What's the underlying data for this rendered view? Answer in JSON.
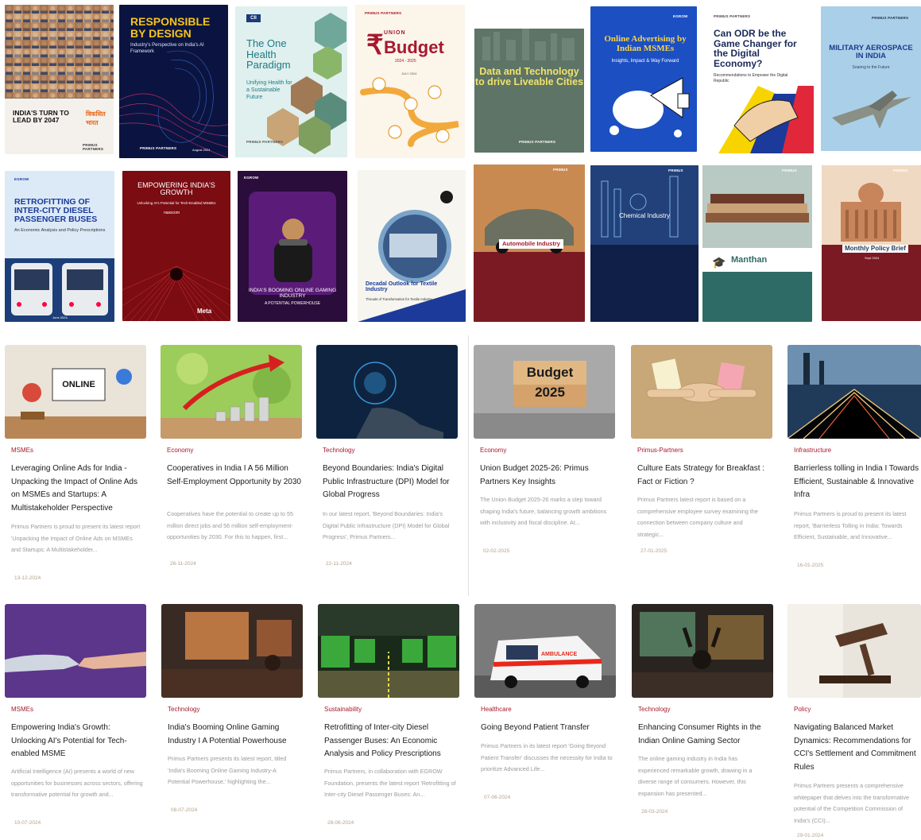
{
  "covers_row1": [
    {
      "title": "INDIA'S TURN TO LEAD BY 2047",
      "badge": "विकसित भारत",
      "brand": "PRIMUS PARTNERS"
    },
    {
      "title": "RESPONSIBLE BY DESIGN",
      "subtitle": "Industry's Perspective on India's AI Framework",
      "date": "August 2024",
      "brand": "PRIMUS PARTNERS"
    },
    {
      "org": "CII",
      "title": "The One Health Paradigm",
      "subtitle": "Unifying Health for a Sustainable Future",
      "brand": "PRIMUS PARTNERS"
    },
    {
      "brand": "PRIMUS PARTNERS",
      "title": "Budget",
      "prefix": "UNION",
      "years": "2024 - 2025",
      "date": "JULY 2024"
    },
    {
      "title": "Data and Technology to drive Liveable Cities",
      "brand": "PRIMUS PARTNERS"
    },
    {
      "brand": "EGROW",
      "title": "Online Advertising by Indian MSMEs",
      "subtitle": "Insights, Impact & Way Forward"
    },
    {
      "brand": "PRIMUS PARTNERS",
      "title": "Can ODR be the Game Changer for the Digital Economy?",
      "subtitle": "Recommendations to Empower the Digital Republic"
    },
    {
      "brand": "PRIMUS PARTNERS",
      "title": "MILITARY AEROSPACE IN INDIA",
      "subtitle": "Soaring to the Future"
    }
  ],
  "covers_row2": [
    {
      "brand": "EGROW",
      "title": "RETROFITTING OF INTER-CITY DIESEL PASSENGER BUSES",
      "subtitle": "An Economic Analysis and Policy Prescriptions",
      "date": "June 2024"
    },
    {
      "title": "EMPOWERING INDIA'S GROWTH",
      "subtitle": "Unlocking AI's Potential for Tech-Enabled MSMEs",
      "org": "nasscom",
      "partner": "Meta"
    },
    {
      "brand": "EGROW",
      "title": "INDIA'S BOOMING ONLINE GAMING INDUSTRY",
      "subtitle": "A POTENTIAL POWERHOUSE"
    },
    {
      "title": "Decadal Outlook for Textile Industry",
      "subtitle": "Threads of Transformation for Textile Industry"
    },
    {
      "brand": "PRIMUS",
      "title": "Automobile Industry"
    },
    {
      "brand": "PRIMUS",
      "title": "Chemical Industry"
    },
    {
      "brand": "PRIMUS",
      "title": "Manthan"
    },
    {
      "brand": "PRIMUS",
      "title": "Monthly Policy Brief",
      "date": "Sept 2024"
    }
  ],
  "articles_row1": [
    {
      "category": "MSMEs",
      "title": "Leveraging Online Ads for India - Unpacking the Impact of Online Ads on MSMEs and Startups: A Multistakeholder Perspective",
      "excerpt": "Primus Partners is proud to present its latest report 'Unpacking the Impact of Online Ads on MSMEs and Startups: A Multistakeholder...",
      "date": "13-12-2024",
      "thumb_label": "ONLINE"
    },
    {
      "category": "Economy",
      "title": "Cooperatives in India I A 56 Million Self-Employment Opportunity by 2030",
      "excerpt": "Cooperatives have the potential to create up to 55 million direct jobs and 56 million self-employment-opportunities by 2030. For this to happen, first...",
      "date": "26-11-2024"
    },
    {
      "category": "Technology",
      "title": "Beyond Boundaries: India's Digital Public Infrastructure (DPI) Model for Global Progress",
      "excerpt": "In our latest report, 'Beyond Boundaries: India's Digital Public Infrastructure (DPI) Model for Global Progress', Primus Partners...",
      "date": "22-11-2024"
    },
    {
      "category": "Economy",
      "title": "Union Budget 2025-26: Primus Partners Key Insights",
      "excerpt": "The Union Budget 2025-26 marks a step toward shaping India's future, balancing growth ambitions with inclusivity and fiscal discipline. At...",
      "date": "02-02-2025",
      "thumb_label": "Budget 2025"
    },
    {
      "category": "Primus-Partners",
      "title": "Culture Eats Strategy for Breakfast : Fact or Fiction ?",
      "excerpt": "Primus Partners latest report is based on a comprehensive employee survey examining the connection between company culture and strategic...",
      "date": "27-01-2025"
    },
    {
      "category": "Infrastructure",
      "title": "Barrierless tolling in India I Towards Efficient, Sustainable & Innovative Infra",
      "excerpt": "Primus Partners is proud to present its latest report, 'Barrierless Tolling in India: Towards Efficient, Sustainable, and Innovative...",
      "date": "16-01-2025"
    }
  ],
  "articles_row2": [
    {
      "category": "MSMEs",
      "title": "Empowering India's Growth: Unlocking AI's Potential for Tech-enabled MSME",
      "excerpt": "Artificial Intelligence (AI) presents a world of new opportunities for businesses across sectors, offering transformative potential for growth and...",
      "date": "10-07-2024"
    },
    {
      "category": "Technology",
      "title": "India's Booming Online Gaming Industry I A Potential Powerhouse",
      "excerpt": "Primus Partners presents its latest report, titled 'India's Booming Online Gaming Industry-A Potential Powerhouse,' highlighting the...",
      "date": "08-07-2024"
    },
    {
      "category": "Sustainability",
      "title": "Retrofitting of Inter-city Diesel Passenger Buses: An Economic Analysis and Policy Prescriptions",
      "excerpt": "Primus Partners, in collaboration with EGROW Foundation, presents the latest report 'Retrofitting of Inter-city Diesel Passenger Buses: An...",
      "date": "28-06-2024"
    },
    {
      "category": "Healthcare",
      "title": "Going Beyond Patient Transfer",
      "excerpt": "Primus Partners in its latest report 'Going Beyond Patient Transfer' discusses the necessity for India to prioritize Advanced Life...",
      "date": "07-06-2024",
      "thumb_label": "AMBULANCE"
    },
    {
      "category": "Technology",
      "title": "Enhancing Consumer Rights in the Indian Online Gaming Sector",
      "excerpt": "The online gaming industry in India has experienced remarkable growth, drawing in a diverse range of consumers. However, this expansion has presented...",
      "date": "28-03-2024"
    },
    {
      "category": "Policy",
      "title": "Navigating Balanced Market Dynamics: Recommendations for CCI's Settlement and Commitment Rules",
      "excerpt": "Primus Partners presents a comprehensive whitepaper that delves into the transformative potential of the Competition Commission of India's (CCI)...",
      "date": "29-01-2024"
    }
  ]
}
